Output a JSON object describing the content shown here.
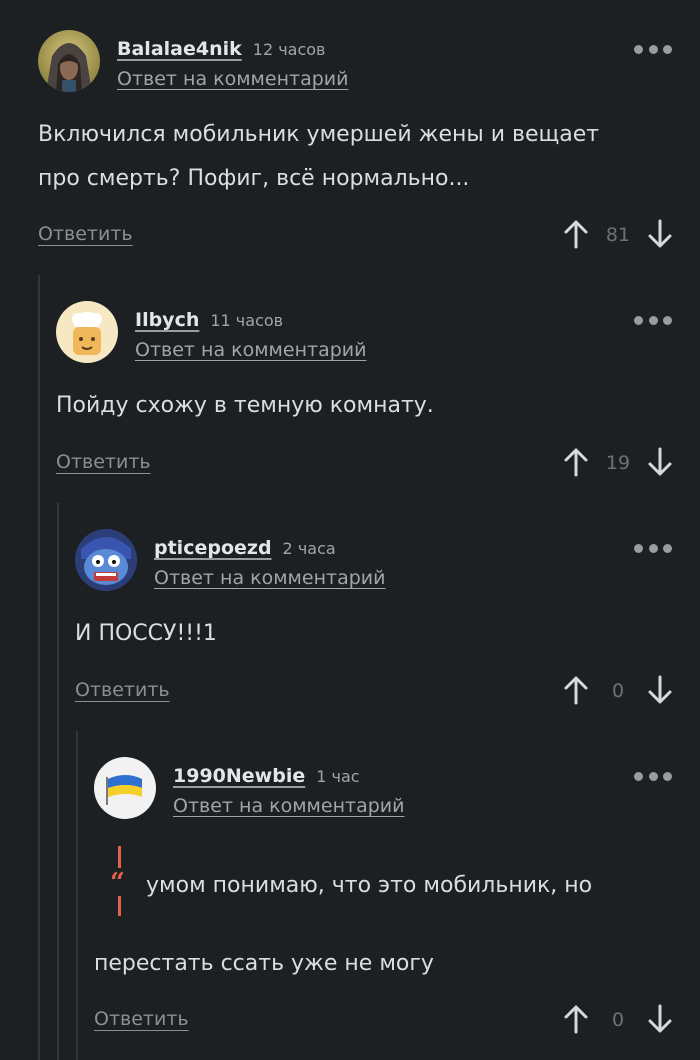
{
  "comments": [
    {
      "username": "Balalae4nik",
      "time": "12 часов",
      "reply_to": "Ответ на комментарий",
      "text_lines": [
        "Включился мобильник умершей жены и вещает",
        "про смерть? Пофиг, всё нормально..."
      ],
      "answer_label": "Ответить",
      "votes": "81",
      "avatar": "hooded-assassin"
    },
    {
      "username": "Ilbych",
      "time": "11 часов",
      "reply_to": "Ответ на комментарий",
      "text_lines": [
        "Пойду схожу в темную комнату."
      ],
      "answer_label": "Ответить",
      "votes": "19",
      "avatar": "cartoon-chef"
    },
    {
      "username": "pticepoezd",
      "time": "2 часа",
      "reply_to": "Ответ на комментарий",
      "text_lines": [
        "И ПОССУ!!!1"
      ],
      "answer_label": "Ответить",
      "votes": "0",
      "avatar": "scared-cartoon-face"
    },
    {
      "username": "1990Newbie",
      "time": "1 час",
      "reply_to": "Ответ на комментарий",
      "quote_first_line": "умом понимаю, что это мобильник, но",
      "text_lines": [
        "перестать ссать уже не могу"
      ],
      "answer_label": "Ответить",
      "votes": "0",
      "avatar": "ukraine-flag-badge"
    }
  ],
  "colors": {
    "background": "#1d2022",
    "quote_accent": "#e0604a",
    "muted": "#8c8e90"
  },
  "icons": {
    "more": "more-dots-icon",
    "upvote": "arrow-up-icon",
    "downvote": "arrow-down-icon",
    "quote": "quote-icon"
  }
}
